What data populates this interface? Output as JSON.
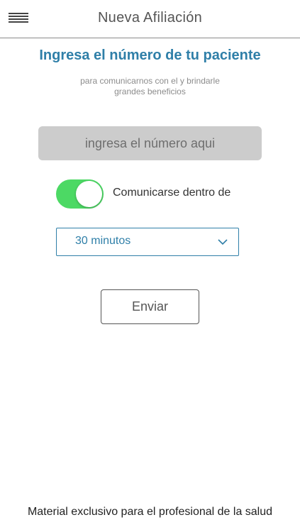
{
  "header": {
    "title": "Nueva Afiliación",
    "menu_icon": "hamburger-menu-icon"
  },
  "main": {
    "headline": "Ingresa el número de tu paciente",
    "subtext_line1": "para comunicarnos con el y brindarle",
    "subtext_line2": "grandes beneficios",
    "number_input": {
      "value": "",
      "placeholder": "ingresa el número aqui"
    },
    "toggle": {
      "on": true,
      "label": "Comunicarse dentro de"
    },
    "time_select": {
      "selected": "30 minutos",
      "icon": "chevron-down-icon"
    },
    "send_button": "Enviar"
  },
  "footer": {
    "text": "Material exclusivo para el profesional de la salud"
  },
  "colors": {
    "accent": "#2f7fa8",
    "toggle_on": "#4cd964",
    "input_bg": "#cccccc"
  }
}
